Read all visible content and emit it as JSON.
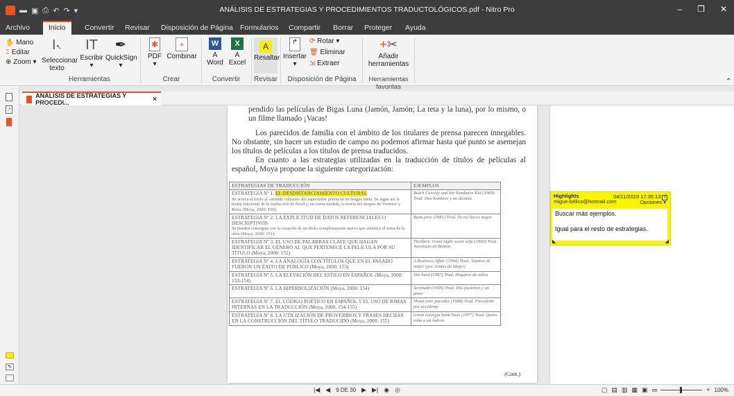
{
  "app": {
    "window_title": "ANÁLISIS DE ESTRATEGIAS Y PROCEDIMIENTOS TRADUCTOLÓGICOS.pdf - Nitro Pro",
    "accent_color": "#e8531f",
    "highlight_color": "#f6ec18"
  },
  "window_controls": {
    "minimize": "–",
    "restore": "❐",
    "close": "✕"
  },
  "menu": {
    "tabs": [
      "Archivo",
      "Inicio",
      "Convertir",
      "Revisar",
      "Disposición de Página",
      "Formularios",
      "Compartir",
      "Borrar",
      "Proteger",
      "Ayuda"
    ],
    "active": "Inicio"
  },
  "ribbon": {
    "mano": "Mano",
    "editar": "Editar",
    "zoom": "Zoom",
    "seleccionar_texto_1": "Seleccionar",
    "seleccionar_texto_2": "texto",
    "escribir": "Escribir",
    "quicksign": "QuickSign",
    "herramientas": "Herramientas",
    "pdf": "PDF",
    "combinar": "Combinar",
    "crear": "Crear",
    "word": "Word",
    "excel": "Excel",
    "convertir": "Convertir",
    "resaltar": "Resaltar",
    "revisar": "Revisar",
    "insertar": "Insertar",
    "rotar": "Rotar",
    "eliminar": "Eliminar",
    "extraer": "Extraer",
    "disposicion": "Disposición de Página",
    "anadir_1": "Añadir",
    "anadir_2": "herramientas",
    "favoritas": "Herramientas favoritas"
  },
  "document_tab": {
    "label": "ANÁLISIS DE ESTRATEGIAS Y PROCEDI...",
    "close": "×"
  },
  "page": {
    "para1": "pendido las películas de Bigas Luna (Jamón, Jamón; La teta y la luna), por lo mismo, o un filme llamado ¡Vacas!",
    "para2": "Los parecidos de familia con el ámbito de los titulares de prensa parecen innegables. No obstante, sin hacer un estudio de campo no podemos afirmar hasta qué punto se asemejan los títulos de películas a los títulos de prensa traducidos.",
    "para3": "En cuanto a las estrategias utilizadas en la traducción de títulos de películas al español, Moya propone la siguiente categorización:",
    "table_head_left": "ESTRATEGIAS DE TRADUCCIÓN",
    "table_head_right": "EJEMPLOS",
    "rows": [
      {
        "prefix": "ESTRATEGIA Nº 1.",
        "highlight": "EL DESDISTANCIAMIENTO CULTURAL",
        "sub": "Se acerca el título al «mundo cultural» del espectador potencial en lengua meta. Se sigue así la teoría funcional de la traducción de Nord y, en cierta medida, la teoría del skopos de Vermeer y Reiss (Moya, 2000: 150).",
        "ex": "Butch Cassidy and the Sundance Kid (1969) Trad. Dos hombres y un destino"
      },
      {
        "prefix": "ESTRATEGIA Nº 2. LA EXPLICITUD DE DATOS REFERENCIALES O DESCRIPTIVOS",
        "highlight": "",
        "sub": "Se pueden conseguir con la creación de un título completamente nuevo que sintetice el tema de la obra (Moya, 2000: 151).",
        "ex": "Beau père (1981) Trad. Tu me haces mujer"
      },
      {
        "prefix": "ESTRATEGIA Nº 3. EL USO DE PALABRAS CLAVE QUE HAGAN IDENTIFICAR EL GÉNERO AL QUE PERTENECE LA PELÍCULA POR SU TÍTULO (Moya, 2000: 152)",
        "highlight": "",
        "sub": "",
        "ex": "Thrillers: Good night sweet wife (1990) Trad. Asesinato en Boston"
      },
      {
        "prefix": "ESTRATEGIA Nº 4. LA ANALOGÍA CON TÍTULOS QUE EN EL PASADO FUERON UN ÉXITO DE PÚBLICO (Moya, 2000: 153)",
        "highlight": "",
        "sub": "",
        "ex": "A Business Affair (1994) Trad. Asuntos de mujer (por Armas de Mujer)"
      },
      {
        "prefix": "ESTRATEGIA Nº 5. LA ELEVACIÓN DEL ESTILO EN ESPAÑOL (Moya, 2000: 153-154)",
        "highlight": "",
        "sub": "",
        "ex": "Die hard (1987) Trad. Hoguera de odios"
      },
      {
        "prefix": "ESTRATEGIA Nº 6. LA HIPERBOLIZACIÓN (Moya, 2000: 154)",
        "highlight": "",
        "sub": "",
        "ex": "Serenade (1956) Trad. Dos pasiones y un amor"
      },
      {
        "prefix": "ESTRATEGIA Nº 7. EL CÓDIGO POÉTICO EN ESPAÑOL Y EL USO DE RIMAS INTERNAS EN LA TRADUCCIÓN (Moya, 2000, 154-155)",
        "highlight": "",
        "sub": "",
        "ex": "Moon over parador (1988) Trad. Presidente por accidente"
      },
      {
        "prefix": "ESTRATEGIA Nº 8. LA UTILIZACIÓN DE PROVERBIOS Y FRASES HECHAS EN LA CONSTRUCCIÓN DEL TÍTULO TRADUCIDO (Moya, 2000: 155)",
        "highlight": "",
        "sub": "",
        "ex": "Great Georgia bank hoax (1977) Trad. Quien roba a un ladrón"
      }
    ],
    "cont": "(Cont.)"
  },
  "note": {
    "title": "Highlights",
    "author": "migue-belico@hotmail.com",
    "date": "04/11/2019 17:35:13",
    "options": "Opciones",
    "line1": "Buscar más ejemplos.",
    "line2": "Igual para el resto de estrategias."
  },
  "status": {
    "page_indicator": "9 DE 30",
    "zoom": "100%"
  }
}
